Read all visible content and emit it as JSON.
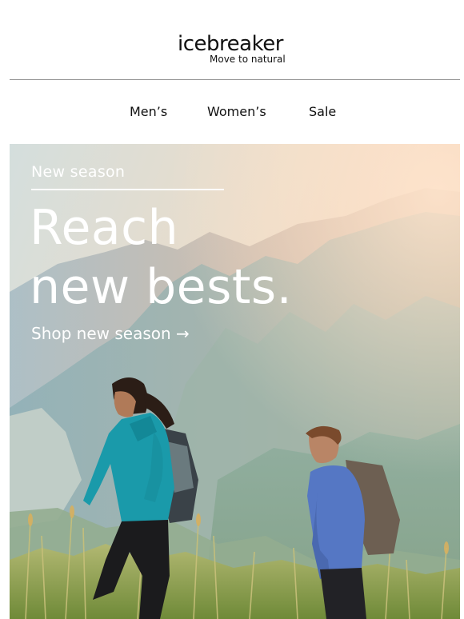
{
  "brand": {
    "name": "icebreaker",
    "tagline": "Move to natural"
  },
  "nav": {
    "items": [
      "Men’s",
      "Women’s",
      "Sale"
    ]
  },
  "hero": {
    "eyebrow": "New season",
    "headline_line1": "Reach",
    "headline_line2": "new bests.",
    "cta": "Shop new season →",
    "image_description_icon": "hikers-photo"
  },
  "colors": {
    "background": "#ffffff",
    "text": "#111111",
    "divider": "#9a9a9a",
    "hero_text": "#ffffff",
    "jacket_teal": "#1a9aaa",
    "jacket_blue": "#5577c4",
    "grass": "#9aa84a"
  }
}
